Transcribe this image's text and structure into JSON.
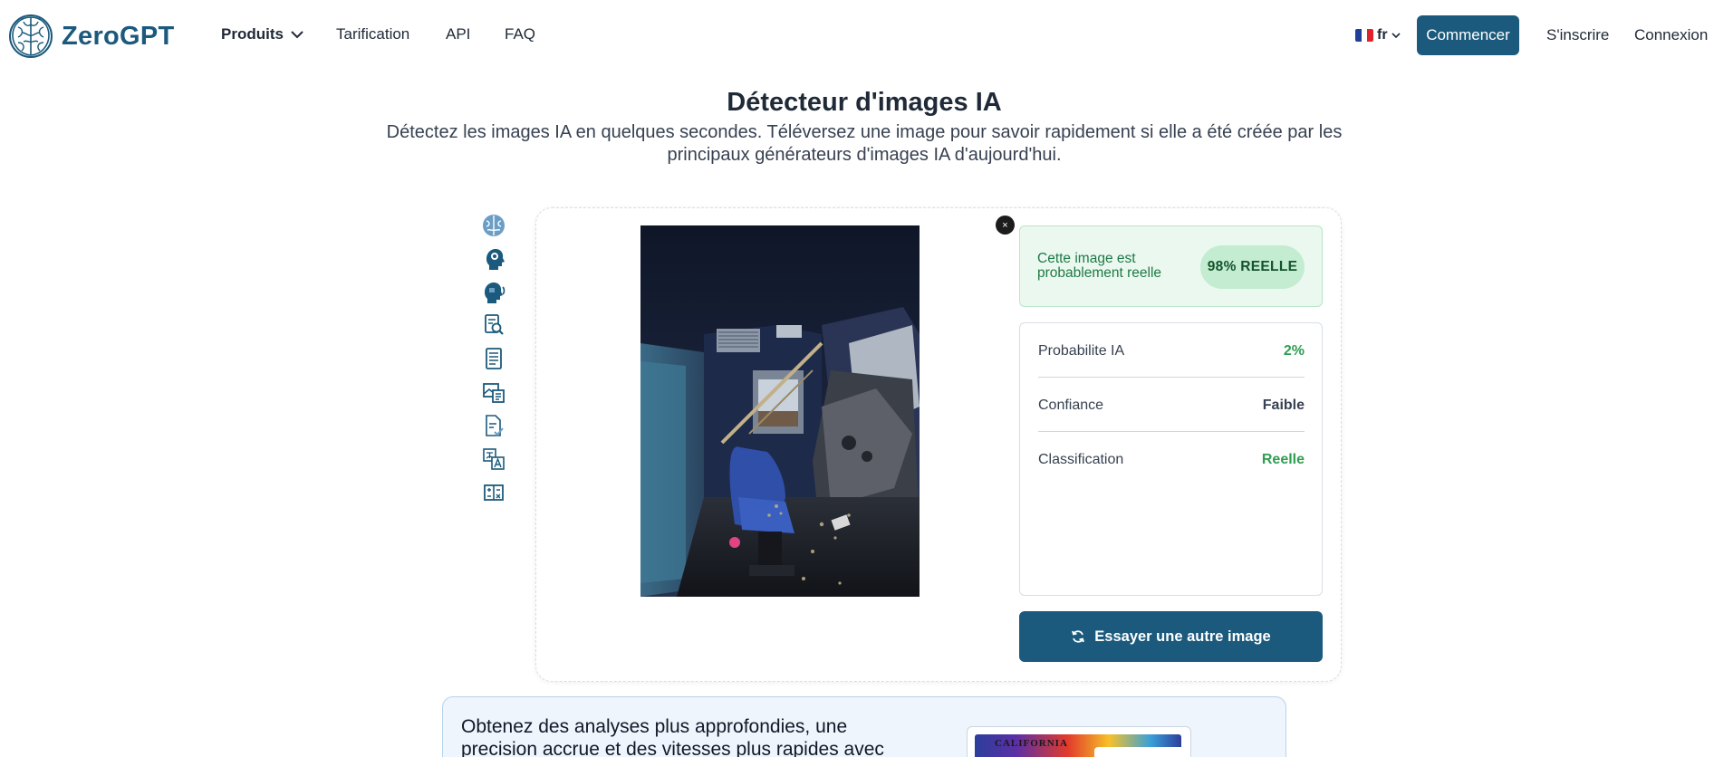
{
  "header": {
    "logo_text": "ZeroGPT",
    "nav": {
      "products": "Produits",
      "pricing": "Tarification",
      "api": "API",
      "faq": "FAQ"
    },
    "language": "fr",
    "start_button": "Commencer",
    "signup": "S'inscrire",
    "login": "Connexion"
  },
  "hero": {
    "title": "Détecteur d'images IA",
    "subtitle": "Détectez les images IA en quelques secondes. Téléversez une image pour savoir rapidement si elle a été créée par les principaux générateurs d'images IA d'aujourd'hui."
  },
  "tool_icons": [
    "brain-icon",
    "head-profile-icon",
    "speaking-head-icon",
    "document-search-icon",
    "document-list-icon",
    "image-scan-icon",
    "document-check-icon",
    "translate-icon",
    "text-compare-icon"
  ],
  "result": {
    "close_symbol": "×",
    "message": "Cette image est probablement reelle",
    "badge": "98% REELLE",
    "stats": [
      {
        "label": "Probabilite IA",
        "value": "2%"
      },
      {
        "label": "Confiance",
        "value": "Faible"
      },
      {
        "label": "Classification",
        "value": "Reelle"
      }
    ],
    "retry_button": "Essayer une autre image"
  },
  "promo": {
    "text": "Obtenez des analyses plus approfondies, une precision accrue et des vitesses plus rapides avec",
    "thumb_label": "CALIFORNIA"
  },
  "colors": {
    "brand": "#1b5a7c",
    "success_text": "#2f9e52",
    "success_bg": "#ebf8f0",
    "badge_bg": "#c3ecd0"
  }
}
